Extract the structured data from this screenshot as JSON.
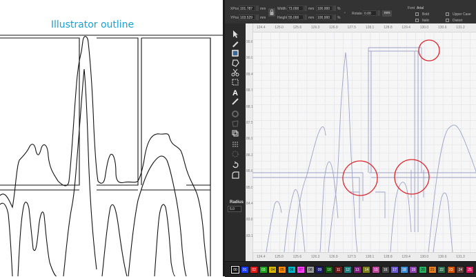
{
  "left_pane": {
    "title": "Illustrator outline"
  },
  "toolbar": {
    "xpos_label": "XPos",
    "xpos_value": "101.787",
    "ypos_label": "YPos",
    "ypos_value": "103.529",
    "width_label": "Width",
    "width_value": "73.000",
    "height_label": "Height",
    "height_value": "55.000",
    "unit": "mm",
    "scale_w": "100.000",
    "scale_h": "100.000",
    "percent": "%",
    "rotate_label": "Rotate",
    "rotate_value": "0.00",
    "rotate_unit": "mm",
    "font_label": "Font",
    "font_value": "Arial",
    "bold": "Bold",
    "italic": "Italic",
    "upper_case": "Upper Case",
    "distort": "Distort"
  },
  "tools": {
    "radius_label": "Radius",
    "radius_value": "5.0"
  },
  "rulers": {
    "top": [
      "124.4",
      "125.0",
      "125.6",
      "126.3",
      "126.9",
      "127.5",
      "128.1",
      "128.8",
      "129.4",
      "130.0",
      "130.6",
      "131.2"
    ],
    "bottom": [
      "124.4",
      "125.0",
      "125.6",
      "126.3",
      "126.9",
      "127.5",
      "128.1",
      "128.8",
      "129.4",
      "130.0",
      "130.6",
      "131.3"
    ],
    "left": [
      "90.6",
      "90.0",
      "89.4",
      "88.7",
      "88.1",
      "87.5",
      "86.9",
      "86.3",
      "85.6",
      "85.0",
      "84.4",
      "83.8",
      "83.1"
    ]
  },
  "palette": {
    "labels": [
      "00",
      "01",
      "02",
      "03",
      "04",
      "05",
      "06",
      "07",
      "08",
      "09",
      "10",
      "11",
      "12",
      "13",
      "14",
      "15",
      "16",
      "17",
      "18",
      "19",
      "20",
      "21",
      "22",
      "23",
      "24",
      "25"
    ],
    "colors": [
      "#111111",
      "#1a3cff",
      "#e31a1a",
      "#1fa31f",
      "#d9b800",
      "#ff8a00",
      "#00b7c9",
      "#ff3dff",
      "#9a9a9a",
      "#1c1c6e",
      "#0d5c0d",
      "#6e1c1c",
      "#1e7f7f",
      "#7f1e7f",
      "#7f7f1e",
      "#c04a9e",
      "#4a4a4a",
      "#6a5acd",
      "#3c8fd8",
      "#8e44ad",
      "#27ae60",
      "#e67e22",
      "#2f6f4f",
      "#d35400",
      "#5d4037",
      "#d81b60"
    ]
  }
}
